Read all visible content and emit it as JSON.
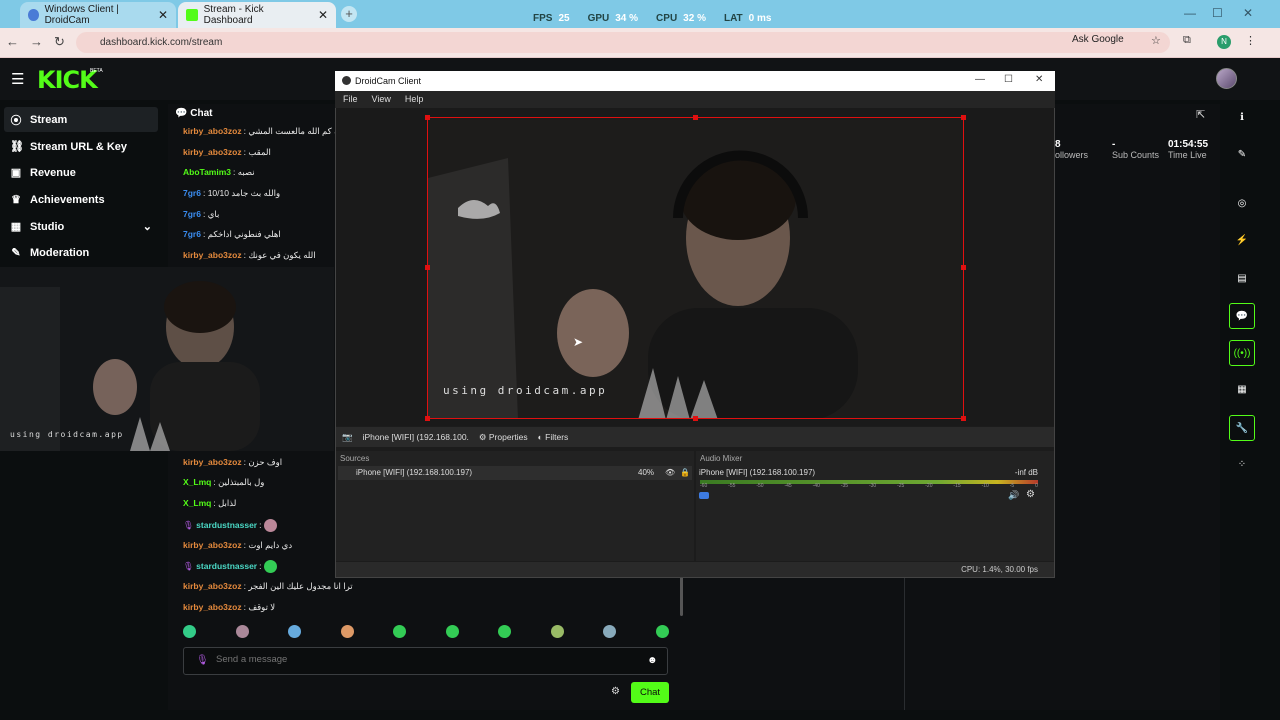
{
  "browser": {
    "tabs": [
      {
        "title": "Windows Client | DroidCam",
        "close": "✕"
      },
      {
        "title": "Stream - Kick Dashboard",
        "close": "✕"
      }
    ],
    "new_tab": "+",
    "stats": [
      {
        "label": "FPS",
        "value": "25"
      },
      {
        "label": "GPU",
        "value": "34 %"
      },
      {
        "label": "CPU",
        "value": "32 %"
      },
      {
        "label": "LAT",
        "value": "0 ms"
      }
    ],
    "url": "dashboard.kick.com/stream",
    "ask_google": "Ask Google",
    "profile_initial": "N",
    "nav": {
      "back": "←",
      "forward": "→",
      "reload": "↻"
    },
    "window_controls": {
      "min": "—",
      "max": "☐",
      "close": "✕"
    }
  },
  "kick": {
    "logo": "KICK",
    "logo_tag": "BETA",
    "sidebar": [
      {
        "label": "Stream",
        "icon": "dot-icon",
        "glyph": "(•)"
      },
      {
        "label": "Stream URL & Key",
        "icon": "link-icon",
        "glyph": "🔗"
      },
      {
        "label": "Revenue",
        "icon": "wallet-icon",
        "glyph": "▣"
      },
      {
        "label": "Achievements",
        "icon": "trophy-icon",
        "glyph": "🏆"
      },
      {
        "label": "Studio",
        "icon": "studio-icon",
        "glyph": "▣",
        "chevron": "⌄"
      },
      {
        "label": "Moderation",
        "icon": "wrench-icon",
        "glyph": "🔧"
      }
    ],
    "chat": {
      "title": "Chat",
      "messages_top": [
        {
          "user": "kirby_abo3zoz",
          "text": "والله كم الله مالعست المشي",
          "color": "#e58a3d"
        },
        {
          "user": "kirby_abo3zoz",
          "text": "المقب",
          "color": "#e58a3d"
        },
        {
          "user": "AboTamim3",
          "text": "نصبه",
          "color": "#53fc18"
        },
        {
          "user": "7gr6",
          "text": "10/10 والله بث جامد",
          "color": "#3b8df0"
        },
        {
          "user": "7gr6",
          "text": "باي",
          "color": "#3b8df0"
        },
        {
          "user": "7gr6",
          "text": "اهلي فنطوني اداخكم",
          "color": "#3b8df0"
        },
        {
          "user": "kirby_abo3zoz",
          "text": "الله يكون في عونك",
          "color": "#e58a3d"
        }
      ],
      "messages_bottom": [
        {
          "user": "kirby_abo3zoz",
          "text": "اوف حزن",
          "color": "#e58a3d"
        },
        {
          "user": "X_Lmq",
          "text": "ول بالمبتذلين",
          "color": "#53fc18"
        },
        {
          "user": "X_Lmq",
          "text": "لذابل",
          "color": "#53fc18"
        },
        {
          "user": "stardustnasser",
          "text": "",
          "color": "#4bd9c6"
        },
        {
          "user": "kirby_abo3zoz",
          "text": "دي دايم اوت",
          "color": "#e58a3d"
        },
        {
          "user": "stardustnasser",
          "text": "",
          "color": "#4bd9c6"
        },
        {
          "user": "kirby_abo3zoz",
          "text": "ترا انا مجدول عليك الين الفجر",
          "color": "#e58a3d"
        },
        {
          "user": "kirby_abo3zoz",
          "text": "لا توقف",
          "color": "#e58a3d"
        }
      ],
      "placeholder": "Send a message",
      "send_label": "Chat"
    },
    "stats": [
      {
        "value": "-",
        "label": "Sub Counts"
      },
      {
        "value": "01:54:55",
        "label": "Time Live"
      },
      {
        "value": "8",
        "label": "ollowers"
      }
    ]
  },
  "droidcam": {
    "title": "DroidCam Client",
    "menu": [
      "File",
      "View",
      "Help"
    ],
    "watermark": "using droidcam.app",
    "source_bar": "iPhone [WIFI] (192.168.100.",
    "properties": "Properties",
    "filters": "Filters",
    "sources_title": "Sources",
    "source_item": "iPhone [WIFI] (192.168.100.197)",
    "source_pct": "40%",
    "mixer_title": "Audio Mixer",
    "mixer_item": "iPhone [WIFI] (192.168.100.197)",
    "mixer_db": "-inf dB",
    "scale": [
      "-60",
      "-55",
      "-50",
      "-45",
      "-40",
      "-35",
      "-30",
      "-25",
      "-20",
      "-15",
      "-10",
      "-5",
      "0"
    ],
    "footer": "CPU: 1.4%, 30.00 fps"
  }
}
